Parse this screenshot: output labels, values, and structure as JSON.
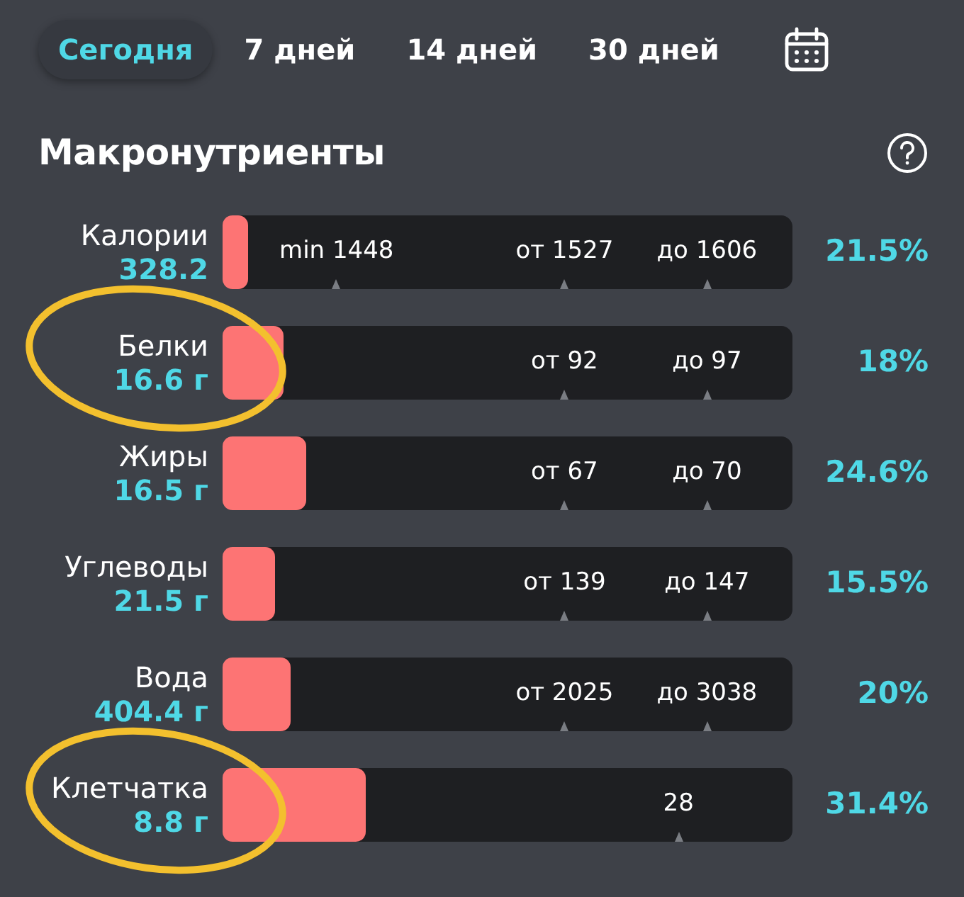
{
  "tabs": [
    {
      "label": "Сегодня",
      "selected": true
    },
    {
      "label": "7 дней",
      "selected": false
    },
    {
      "label": "14 дней",
      "selected": false
    },
    {
      "label": "30 дней",
      "selected": false
    }
  ],
  "section": {
    "title": "Макронутриенты"
  },
  "nutrients": [
    {
      "name": "Калории",
      "amount": "328.2",
      "level": 0.045,
      "markers": [
        {
          "kind": "min",
          "label": "min 1448"
        },
        {
          "kind": "from",
          "label": "от 1527"
        },
        {
          "kind": "to",
          "label": "до 1606"
        }
      ],
      "percent": "21.5%",
      "circled": false
    },
    {
      "name": "Белки",
      "amount": "16.6 г",
      "level": 0.107,
      "markers": [
        {
          "kind": "from",
          "label": "от 92"
        },
        {
          "kind": "to",
          "label": "до 97"
        }
      ],
      "percent": "18%",
      "circled": true
    },
    {
      "name": "Жиры",
      "amount": "16.5 г",
      "level": 0.147,
      "markers": [
        {
          "kind": "from",
          "label": "от 67"
        },
        {
          "kind": "to",
          "label": "до 70"
        }
      ],
      "percent": "24.6%",
      "circled": false
    },
    {
      "name": "Углеводы",
      "amount": "21.5 г",
      "level": 0.092,
      "markers": [
        {
          "kind": "from",
          "label": "от 139"
        },
        {
          "kind": "to",
          "label": "до 147"
        }
      ],
      "percent": "15.5%",
      "circled": false
    },
    {
      "name": "Вода",
      "amount": "404.4 г",
      "level": 0.119,
      "markers": [
        {
          "kind": "from",
          "label": "от 2025"
        },
        {
          "kind": "to",
          "label": "до 3038"
        }
      ],
      "percent": "20%",
      "circled": false
    },
    {
      "name": "Клетчатка",
      "amount": "8.8 г",
      "level": 0.251,
      "markers": [
        {
          "kind": "target",
          "label": "28"
        }
      ],
      "percent": "31.4%",
      "circled": true
    }
  ]
}
